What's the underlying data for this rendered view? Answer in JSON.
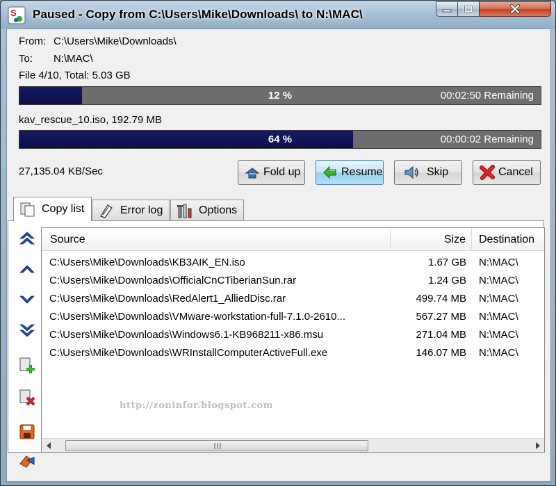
{
  "window": {
    "title": "Paused - Copy from C:\\Users\\Mike\\Downloads\\ to N:\\MAC\\"
  },
  "info": {
    "from_label": "From:",
    "from_value": "C:\\Users\\Mike\\Downloads\\",
    "to_label": "To:",
    "to_value": "N:\\MAC\\",
    "file_summary": "File 4/10, Total: 5.03 GB",
    "current_file": "kav_rescue_10.iso, 192.79 MB",
    "speed": "27,135.04 KB/Sec"
  },
  "progress": {
    "total": {
      "percent": 12,
      "label": "12 %",
      "remaining": "00:02:50 Remaining"
    },
    "file": {
      "percent": 64,
      "label": "64 %",
      "remaining": "00:00:02 Remaining"
    }
  },
  "buttons": {
    "foldup": "Fold up",
    "resume": "Resume",
    "skip": "Skip",
    "cancel": "Cancel"
  },
  "tabs": [
    {
      "label": "Copy list",
      "selected": true
    },
    {
      "label": "Error log",
      "selected": false
    },
    {
      "label": "Options",
      "selected": false
    }
  ],
  "list": {
    "columns": {
      "source": "Source",
      "size": "Size",
      "destination": "Destination"
    },
    "rows": [
      {
        "source": "C:\\Users\\Mike\\Downloads\\KB3AIK_EN.iso",
        "size": "1.67 GB",
        "destination": "N:\\MAC\\"
      },
      {
        "source": "C:\\Users\\Mike\\Downloads\\OfficialCnCTiberianSun.rar",
        "size": "1.24 GB",
        "destination": "N:\\MAC\\"
      },
      {
        "source": "C:\\Users\\Mike\\Downloads\\RedAlert1_AlliedDisc.rar",
        "size": "499.74 MB",
        "destination": "N:\\MAC\\"
      },
      {
        "source": "C:\\Users\\Mike\\Downloads\\VMware-workstation-full-7.1.0-2610...",
        "size": "567.27 MB",
        "destination": "N:\\MAC\\"
      },
      {
        "source": "C:\\Users\\Mike\\Downloads\\Windows6.1-KB968211-x86.msu",
        "size": "271.04 MB",
        "destination": "N:\\MAC\\"
      },
      {
        "source": "C:\\Users\\Mike\\Downloads\\WRInstallComputerActiveFull.exe",
        "size": "146.07 MB",
        "destination": "N:\\MAC\\"
      }
    ]
  },
  "watermark": "http://zoninfor.blogspot.com",
  "colors": {
    "progress_fill": "#151a64",
    "progress_track": "#6d6d6d",
    "title_bar": "#a3bdd3",
    "close_button": "#c2401f",
    "resume_highlight": "#98d0ef"
  }
}
